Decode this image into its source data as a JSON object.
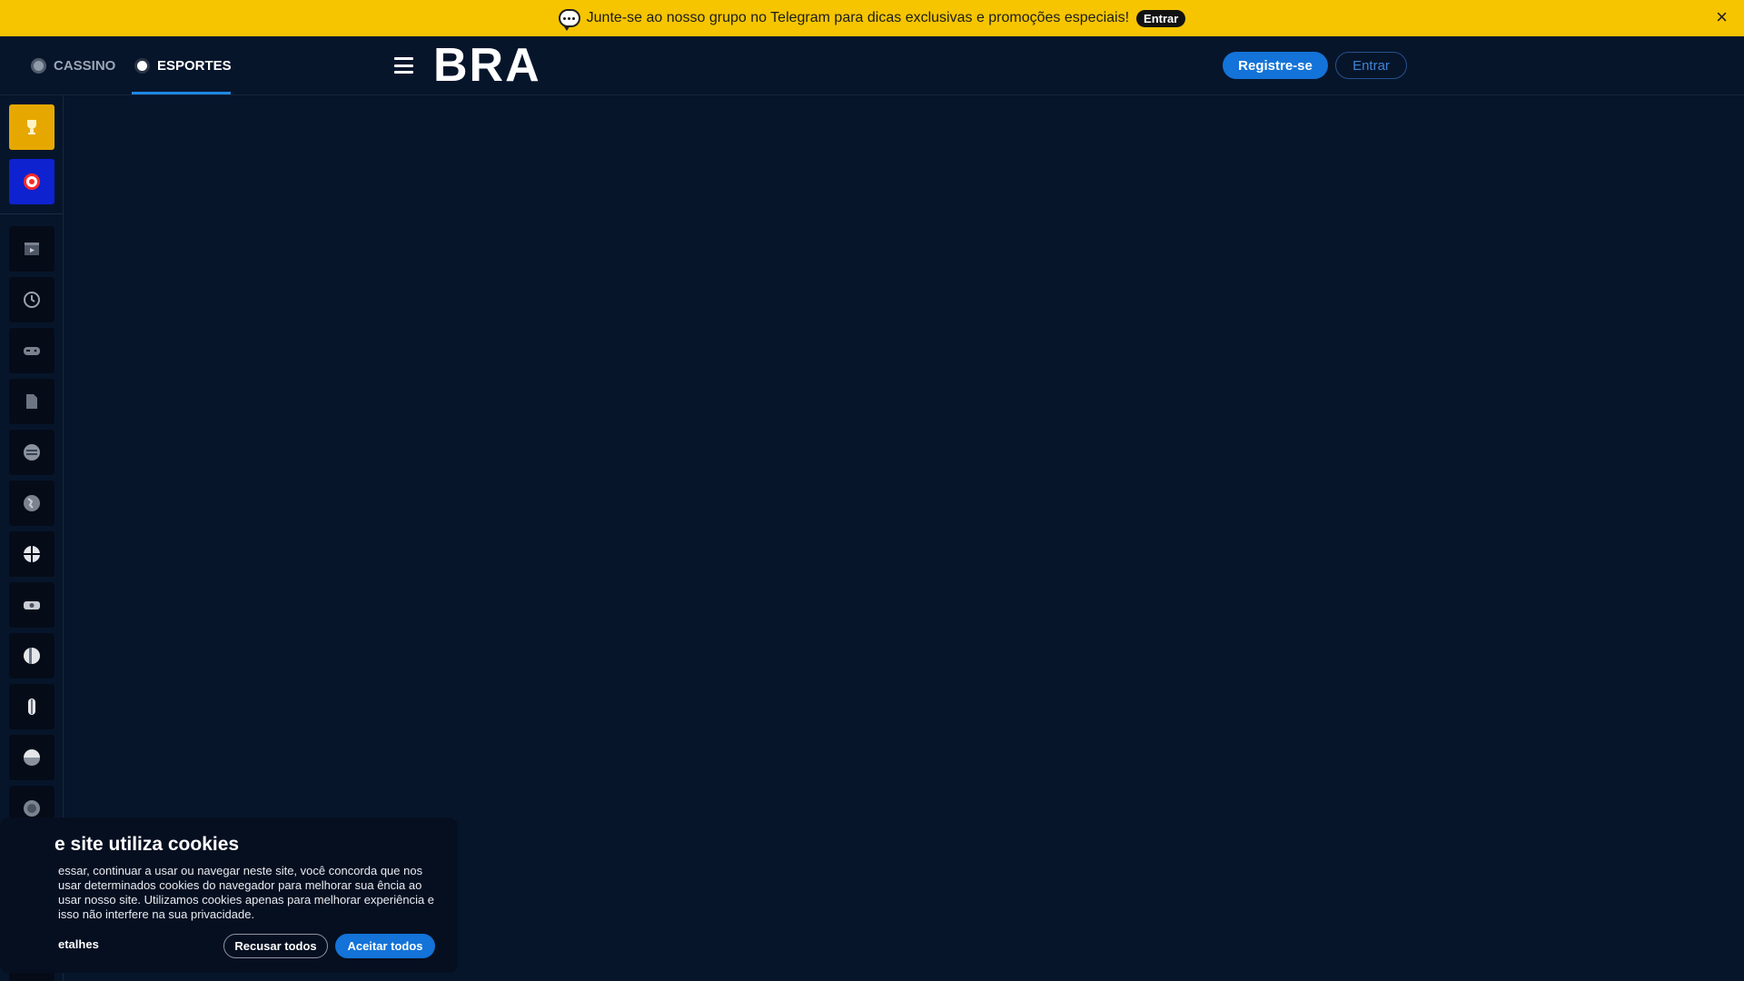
{
  "banner": {
    "text": "Junte-se ao nosso grupo no Telegram para dicas exclusivas e promoções especiais!",
    "button": "Entrar",
    "close": "×"
  },
  "header": {
    "tabs": [
      {
        "label": "CASSINO",
        "active": false
      },
      {
        "label": "ESPORTES",
        "active": true
      }
    ],
    "logo": "BRA",
    "register_label": "Registre-se",
    "login_label": "Entrar"
  },
  "sidebar": {
    "icons": [
      "trophy-icon",
      "target-icon",
      "clapperboard-icon",
      "live-clock-icon",
      "gamepad-icon",
      "document-icon",
      "soccer-icon",
      "globe-icon",
      "basketball-icon",
      "tennis-table-icon",
      "volleyball-icon",
      "baseball-icon",
      "rugby-icon",
      "hockey-icon",
      "nba-icon",
      "nfl-icon",
      "f1-icon"
    ]
  },
  "cookie": {
    "title": "e site utiliza cookies",
    "text": "essar, continuar a usar ou navegar neste site, você concorda que nos usar determinados cookies do navegador para melhorar sua ência ao usar nosso site. Utilizamos cookies apenas para melhorar experiência e isso não interfere na sua privacidade.",
    "details": "etalhes",
    "refuse": "Recusar todos",
    "accept": "Aceitar todos"
  },
  "colors": {
    "background": "#07152b",
    "banner": "#f6c500",
    "accent": "#1373d8"
  }
}
